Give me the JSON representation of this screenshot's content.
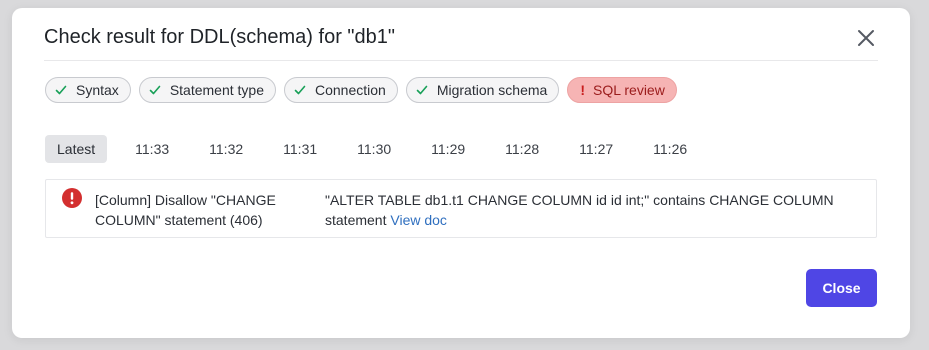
{
  "modal": {
    "title": "Check result for DDL(schema) for \"db1\"",
    "close_icon": "close-icon",
    "close_button_label": "Close"
  },
  "checks": [
    {
      "label": "Syntax",
      "status": "success",
      "icon": "check-icon"
    },
    {
      "label": "Statement type",
      "status": "success",
      "icon": "check-icon"
    },
    {
      "label": "Connection",
      "status": "success",
      "icon": "check-icon"
    },
    {
      "label": "Migration schema",
      "status": "success",
      "icon": "check-icon"
    },
    {
      "label": "SQL review",
      "status": "error",
      "icon": "!"
    }
  ],
  "timeline": {
    "selected": "Latest",
    "items": [
      "Latest",
      "11:33",
      "11:32",
      "11:31",
      "11:30",
      "11:29",
      "11:28",
      "11:27",
      "11:26"
    ]
  },
  "result": {
    "icon": "error-circle-icon",
    "rule_title": "[Column] Disallow \"CHANGE COLUMN\" statement (406)",
    "content": "\"ALTER TABLE db1.t1 CHANGE COLUMN id id int;\" contains CHANGE COLUMN statement",
    "link_label": "View doc"
  },
  "colors": {
    "primary": "#4f46e5",
    "success": "#18a058",
    "error": "#d03050",
    "error_chip_bg": "#f6b4b4",
    "link": "#2f6fbf"
  }
}
